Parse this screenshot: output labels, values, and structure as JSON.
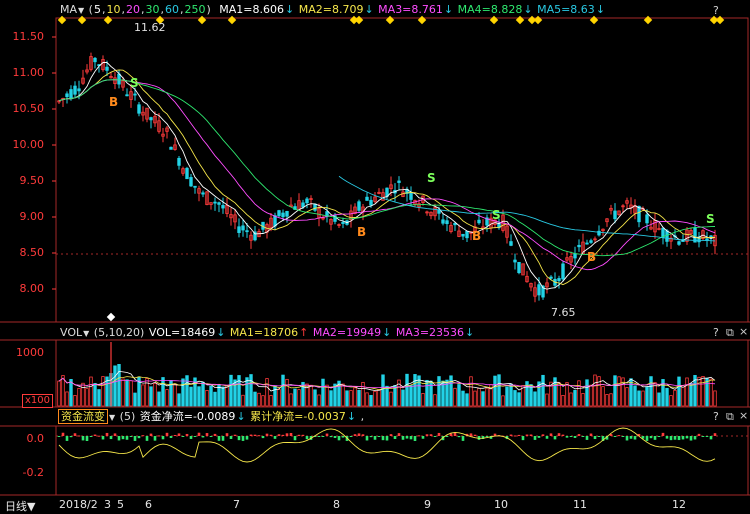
{
  "colors": {
    "frame": "#a52828",
    "up": "#ff3b3b",
    "down": "#22d3e6",
    "ma1": "#ffffff",
    "ma2": "#f5e64a",
    "ma3": "#ff4dff",
    "ma4": "#2ee86f",
    "ma5": "#29c9e3",
    "marker": "#ffd400",
    "buy": "#ff8a1c",
    "sell": "#7cff5b"
  },
  "main_panel": {
    "indicator_name": "MA",
    "dropdown_icon": "chevron-down-icon",
    "params": [
      "5",
      "10",
      "20",
      "30",
      "60",
      "250"
    ],
    "ma_values": [
      {
        "label": "MA1=8.606",
        "arrow": "↓"
      },
      {
        "label": "MA2=8.709",
        "arrow": "↓"
      },
      {
        "label": "MA3=8.761",
        "arrow": "↓"
      },
      {
        "label": "MA4=8.828",
        "arrow": "↓"
      },
      {
        "label": "MA5=8.63",
        "arrow": "↓"
      }
    ],
    "y_ticks": [
      "11.50",
      "11.00",
      "10.50",
      "10.00",
      "9.50",
      "9.00",
      "8.50",
      "8.00"
    ],
    "y_tick_values": [
      11.5,
      11.0,
      10.5,
      10.0,
      9.5,
      9.0,
      8.5,
      8.0
    ],
    "high_label": "11.62",
    "low_label": "7.65",
    "signals": [
      {
        "text": "B",
        "type": "buy"
      },
      {
        "text": "S",
        "type": "sell"
      },
      {
        "text": "B",
        "type": "buy"
      },
      {
        "text": "S",
        "type": "sell"
      },
      {
        "text": "B",
        "type": "buy"
      },
      {
        "text": "S",
        "type": "sell"
      },
      {
        "text": "B",
        "type": "buy"
      },
      {
        "text": "S",
        "type": "sell"
      }
    ]
  },
  "volume_panel": {
    "indicator_name": "VOL",
    "dropdown_icon": "chevron-down-icon",
    "params": "(5,10,20)",
    "values": [
      {
        "label": "VOL=18469",
        "arrow": "↓"
      },
      {
        "label": "MA1=18706",
        "arrow": "↑"
      },
      {
        "label": "MA2=19949",
        "arrow": "↓"
      },
      {
        "label": "MA3=23536",
        "arrow": "↓"
      }
    ],
    "y_tick": "1000",
    "unit_label": "x100"
  },
  "fund_panel": {
    "indicator_name": "资金流变",
    "params": "(5)",
    "values": [
      {
        "label": "资金净流=-0.0089",
        "arrow": "↓"
      },
      {
        "label": "累计净流=-0.0037",
        "arrow": "↓"
      }
    ],
    "trailing": ",",
    "y_ticks": [
      "0.0",
      "-0.2"
    ]
  },
  "window_controls": {
    "help": "?",
    "restore": "⧉",
    "close": "×"
  },
  "bottom_axis": {
    "period_label": "日线",
    "period_icon": "arrow-down-icon",
    "dates": [
      "2018/2",
      "3",
      "5",
      "6",
      "7",
      "8",
      "9",
      "10",
      "11",
      "12"
    ]
  }
}
